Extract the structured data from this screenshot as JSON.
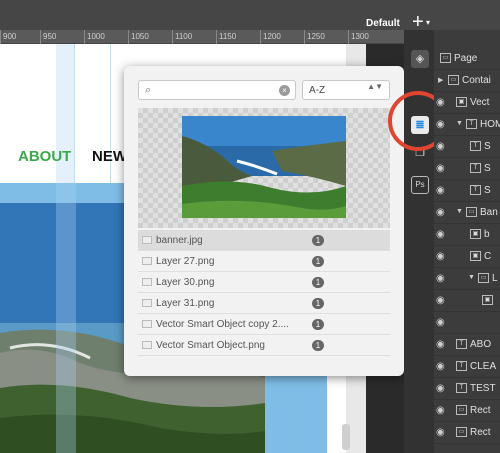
{
  "topbar": {
    "workspace": "Default",
    "add": "+",
    "caret": "▾"
  },
  "ruler": {
    "ticks": [
      "900",
      "950",
      "1000",
      "1050",
      "1100",
      "1150",
      "1200",
      "1250",
      "1300"
    ]
  },
  "canvas": {
    "nav_about": "ABOUT",
    "nav_new": "NEW"
  },
  "popover": {
    "search_placeholder": "",
    "search_icon": "⌕",
    "clear_icon": "×",
    "sort_label": "A-Z",
    "sort_arrows": "▲▼",
    "assets": [
      {
        "name": "banner.jpg",
        "count": "1"
      },
      {
        "name": "Layer 27.png",
        "count": "1"
      },
      {
        "name": "Layer 30.png",
        "count": "1"
      },
      {
        "name": "Layer 31.png",
        "count": "1"
      },
      {
        "name": "Vector Smart Object copy 2....",
        "count": "1"
      },
      {
        "name": "Vector Smart Object.png",
        "count": "1"
      }
    ]
  },
  "tools": {
    "layers_icon": "◈",
    "assets_icon": "≣",
    "states_icon": "❐",
    "ps_label": "Ps"
  },
  "layers": {
    "items": [
      {
        "label": "Page",
        "icon": "▭"
      },
      {
        "label": "Contai",
        "icon": "▭"
      },
      {
        "label": "Vect",
        "icon": "▣"
      },
      {
        "label": "HOME",
        "icon": "T"
      },
      {
        "label": "S",
        "icon": "T"
      },
      {
        "label": "S",
        "icon": "T"
      },
      {
        "label": "S",
        "icon": "T"
      },
      {
        "label": "Ban",
        "icon": "▭"
      },
      {
        "label": "b",
        "icon": "▣"
      },
      {
        "label": "C",
        "icon": "▣"
      },
      {
        "label": "L",
        "icon": "▭"
      },
      {
        "label": "",
        "icon": "▣"
      },
      {
        "label": "",
        "icon": ""
      },
      {
        "label": "ABO",
        "icon": "T"
      },
      {
        "label": "CLEA",
        "icon": "T"
      },
      {
        "label": "TEST",
        "icon": "T"
      },
      {
        "label": "Rect",
        "icon": "▭"
      },
      {
        "label": "Rect",
        "icon": "▭"
      }
    ]
  }
}
